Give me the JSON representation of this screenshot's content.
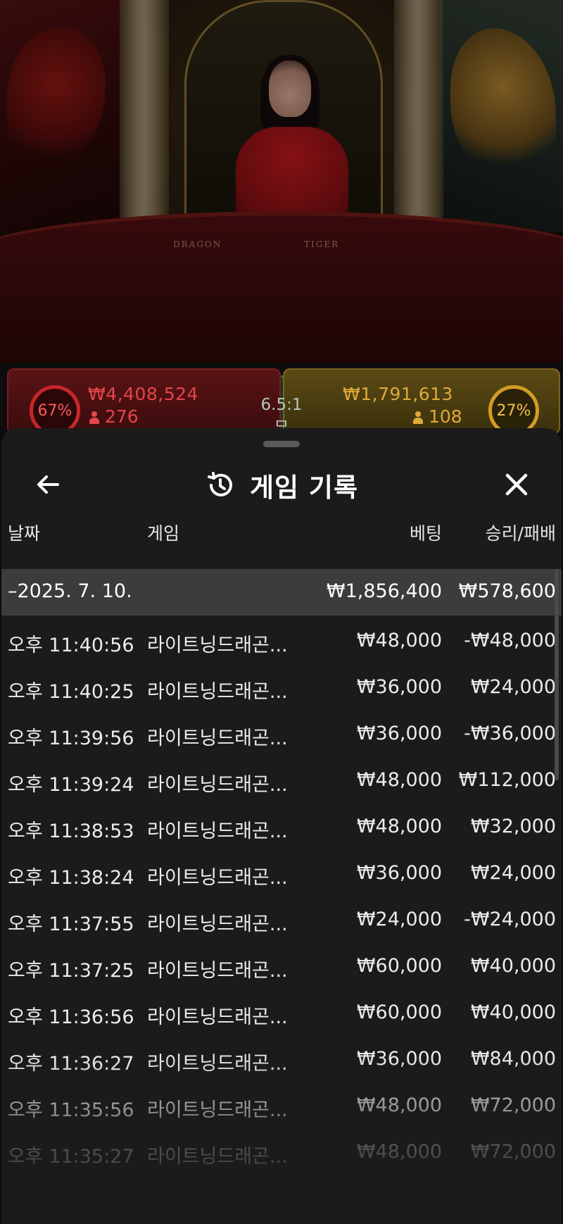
{
  "video": {
    "table_label_dragon": "DRAGON",
    "table_label_tiger": "TIGER"
  },
  "betting": {
    "dragon": {
      "percent": "67%",
      "amount": "₩4,408,524",
      "players": "276",
      "color": "#e2464a"
    },
    "tiger": {
      "percent": "27%",
      "amount": "₩1,791,613",
      "players": "108",
      "color": "#e0a93b"
    },
    "tie": {
      "odds": "6.5:1",
      "label": "무"
    }
  },
  "sheet": {
    "title": "게임 기록",
    "title_icon": "history-icon",
    "back_icon": "arrow-left-icon",
    "close_icon": "close-icon",
    "columns": {
      "date": "날짜",
      "game": "게임",
      "bet": "베팅",
      "result": "승리/패배"
    },
    "summary": {
      "date": "–2025. 7. 10.",
      "bet": "₩1,856,400",
      "result": "₩578,600"
    },
    "rows": [
      {
        "time": "오후 11:40:56",
        "game": "라이트닝드래곤...",
        "bet": "₩48,000",
        "result": "-₩48,000"
      },
      {
        "time": "오후 11:40:25",
        "game": "라이트닝드래곤...",
        "bet": "₩36,000",
        "result": "₩24,000"
      },
      {
        "time": "오후 11:39:56",
        "game": "라이트닝드래곤...",
        "bet": "₩36,000",
        "result": "-₩36,000"
      },
      {
        "time": "오후 11:39:24",
        "game": "라이트닝드래곤...",
        "bet": "₩48,000",
        "result": "₩112,000"
      },
      {
        "time": "오후 11:38:53",
        "game": "라이트닝드래곤...",
        "bet": "₩48,000",
        "result": "₩32,000"
      },
      {
        "time": "오후 11:38:24",
        "game": "라이트닝드래곤...",
        "bet": "₩36,000",
        "result": "₩24,000"
      },
      {
        "time": "오후 11:37:55",
        "game": "라이트닝드래곤...",
        "bet": "₩24,000",
        "result": "-₩24,000"
      },
      {
        "time": "오후 11:37:25",
        "game": "라이트닝드래곤...",
        "bet": "₩60,000",
        "result": "₩40,000"
      },
      {
        "time": "오후 11:36:56",
        "game": "라이트닝드래곤...",
        "bet": "₩60,000",
        "result": "₩40,000"
      },
      {
        "time": "오후 11:36:27",
        "game": "라이트닝드래곤...",
        "bet": "₩36,000",
        "result": "₩84,000"
      },
      {
        "time": "오후 11:35:56",
        "game": "라이트닝드래곤...",
        "bet": "₩48,000",
        "result": "₩72,000"
      },
      {
        "time": "오후 11:35:27",
        "game": "라이트닝드래곤...",
        "bet": "₩48,000",
        "result": "₩72,000"
      }
    ]
  }
}
